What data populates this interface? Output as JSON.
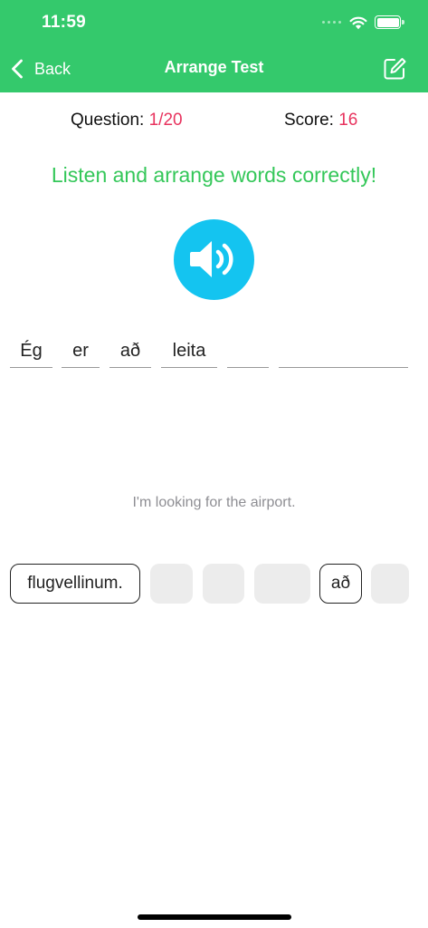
{
  "status_bar": {
    "time": "11:59"
  },
  "nav": {
    "back_label": "Back",
    "title": "Arrange Test"
  },
  "progress": {
    "question_label": "Question: ",
    "question_value": "1/20",
    "score_label": "Score: ",
    "score_value": "16"
  },
  "instruction": "Listen and arrange words correctly!",
  "answer_slots": [
    "Ég",
    "er",
    "að",
    "leita",
    "",
    ""
  ],
  "translation": "I'm looking for the airport.",
  "word_tiles": [
    {
      "text": "flugvellinum.",
      "state": "available"
    },
    {
      "text": "",
      "state": "used"
    },
    {
      "text": "",
      "state": "used"
    },
    {
      "text": "",
      "state": "used"
    },
    {
      "text": "að",
      "state": "available"
    },
    {
      "text": "",
      "state": "used"
    }
  ],
  "colors": {
    "header": "#34c96c",
    "accent_green": "#34c759",
    "highlight_red": "#e8345f",
    "speaker_blue": "#14c4f0"
  }
}
